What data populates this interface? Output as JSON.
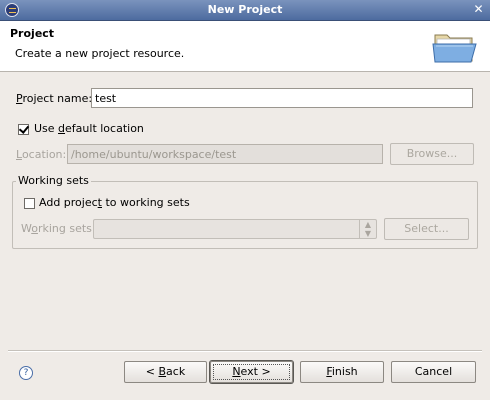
{
  "window": {
    "title": "New Project"
  },
  "banner": {
    "title": "Project",
    "description": "Create a new project resource."
  },
  "project_name": {
    "label_prefix": "",
    "label_mnemonic": "P",
    "label_rest": "roject name:",
    "value": "test"
  },
  "default_location": {
    "checked": true,
    "label_before": "Use ",
    "label_mnemonic": "d",
    "label_after": "efault location"
  },
  "location": {
    "label_mnemonic": "L",
    "label_rest": "ocation:",
    "value": "/home/ubuntu/workspace/test",
    "browse_label": "Browse..."
  },
  "working_sets": {
    "group_label": "Working sets",
    "add_checked": false,
    "add_label_before": "Add projec",
    "add_label_mnemonic": "t",
    "add_label_after": " to working sets",
    "field_label_before": "W",
    "field_label_mnemonic": "o",
    "field_label_after": "rking sets:",
    "select_label": "Select..."
  },
  "buttons": {
    "back_before": "< ",
    "back_mnemonic": "B",
    "back_after": "ack",
    "next_mnemonic": "N",
    "next_after": "ext >",
    "finish_mnemonic": "F",
    "finish_after": "inish",
    "cancel_label": "Cancel"
  },
  "icons": {
    "help": "help-icon",
    "folder": "folder-icon",
    "close": "close-icon",
    "app": "eclipse-app-icon"
  }
}
